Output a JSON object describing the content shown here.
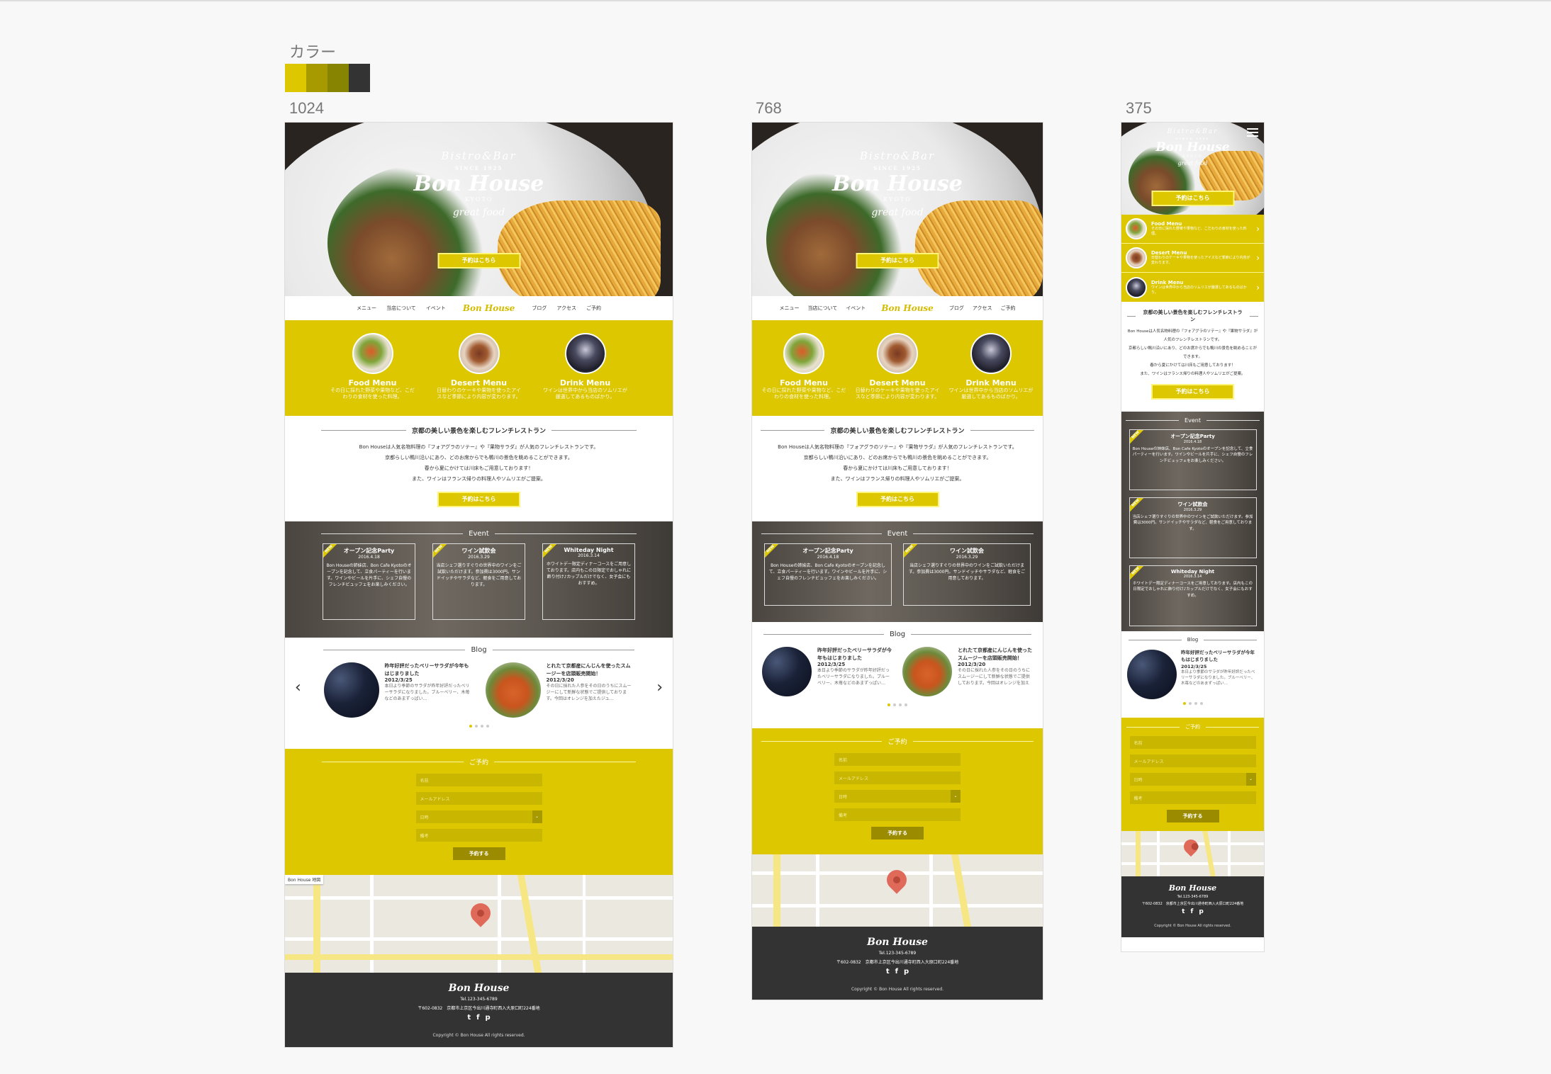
{
  "palette": {
    "label": "カラー",
    "colors": [
      "#dcc700",
      "#a69a00",
      "#868400",
      "#333333"
    ]
  },
  "frames": [
    "1024",
    "768",
    "375"
  ],
  "hero": {
    "bistro": "Bistro&Bar",
    "since": "SINCE 1925",
    "name": "Bon House",
    "kyoto": "KYOTO",
    "tagline": "great food",
    "reserve": "予約はこちら"
  },
  "nav": {
    "left": [
      "メニュー",
      "当店について",
      "イベント"
    ],
    "logo": "Bon House",
    "right": [
      "ブログ",
      "アクセス",
      "ご予約"
    ]
  },
  "menus": [
    {
      "title": "Food Menu",
      "desc": "その日に採れた野菜や果物など、こだわりの食材を使った料理。"
    },
    {
      "title": "Desert Menu",
      "desc": "日替わりのケーキや果物を使ったアイスなど季節により内容が変わります。"
    },
    {
      "title": "Drink Menu",
      "desc": "ワインは世界中から当店のソムリエが厳選してあるものばかり。"
    }
  ],
  "intro": {
    "heading": "京都の美しい景色を楽しむフレンチレストラン",
    "lines": [
      "Bon Houseは人気名物料理の『フォアグラのソテー』や『果物サラダ』が人気のフレンチレストランです。",
      "京都らしい鴨川沿いにあり、どのお席からでも鴨川の景色を眺めることができます。",
      "春から夏にかけては川床もご用意しております！",
      "また、ワインはフランス帰りの料理人やソムリエがご提案。"
    ],
    "reserve": "予約はこちら"
  },
  "event": {
    "heading": "Event",
    "ribbon": "NEW",
    "items": [
      {
        "title": "オープン記念Party",
        "date": "2016.4.18",
        "desc": "Bon Houseの姉妹店、Bon Cafe Kyotoのオープンを記念して、立食パーティーを行います。ワインやビールを片手に、シェフ自慢のフレンチビュッフェをお楽しみください。"
      },
      {
        "title": "ワイン試飲会",
        "date": "2016.3.29",
        "desc": "当店シェフ選りすぐりの世界中のワインをご試飲いただけます。参加費は3000円。サンドイッチやサラダなど、軽食をご用意しております。"
      },
      {
        "title": "Whiteday Night",
        "date": "2016.3.14",
        "desc": "ホワイトデー限定ディナーコースをご用意しております。店内もこの日限定でおしゃれに飾り付け♪カップルだけでなく、女子会にもおすすめ。"
      }
    ]
  },
  "blog": {
    "heading": "Blog",
    "prev": "‹",
    "next": "›",
    "posts": [
      {
        "title": "昨年好評だったベリーサラダが今年もはじまりました",
        "date": "2012/3/25",
        "excerpt": "本日より季節のサラダが昨年好評だったベリーサラダになりました。ブルーベリー、木苺などのあまずっぱい…"
      },
      {
        "title": "とれたて京都産にんじんを使ったスムージーを店頭販売開始！",
        "date": "2012/3/20",
        "excerpt": "その日に採れた人参をその日のうちにスムージーにして新鮮な状態でご提供しております。今回はオレンジを加えたジュ…"
      }
    ]
  },
  "reservation": {
    "heading": "ご予約",
    "name_ph": "名前",
    "email_ph": "メールアドレス",
    "date_ph": "日時",
    "note_ph": "備考",
    "submit": "予約する"
  },
  "map": {
    "tab1": "Bon House",
    "tab2": "地図"
  },
  "footer": {
    "logo": "Bon House",
    "tel": "Tel.123-345-6789",
    "address": "〒602-0832　京都市上京区今出川通寺町西入大原口町224番地",
    "social": [
      "t",
      "f",
      "p"
    ],
    "copyright": "Copyright © Bon House All rights reserved."
  }
}
